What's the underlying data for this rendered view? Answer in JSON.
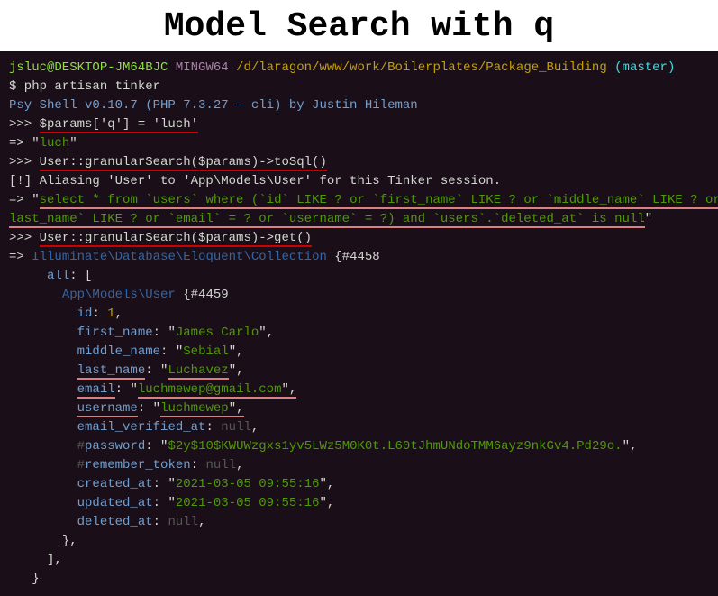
{
  "title": "Model Search with q",
  "prompt": {
    "user": "jsluc@DESKTOP-JM64BJC",
    "shell": " MINGW64 ",
    "path": "/d/laragon/www/work/Boilerplates/Package_Building",
    "branch": " (master)"
  },
  "cmd1": "$ php artisan tinker",
  "psy": "Psy Shell v0.10.7 (PHP 7.3.27 — cli) by Justin Hileman",
  "line1_prompt": ">>> ",
  "line1_code": "$params['q'] = 'luch'",
  "line2_arrow": "=> ",
  "line2_val": "luch",
  "line3_prompt": ">>> ",
  "line3_code": "User::granularSearch($params)->toSql()",
  "alias": "[!] Aliasing 'User' to 'App\\Models\\User' for this Tinker session.",
  "line4_arrow": "=> ",
  "line4_sql_a": "select * from `users` where (`id` LIKE ? or `first_name` LIKE ? or `middle_name` LIKE ? or `",
  "line4_sql_b": "last_name` LIKE ? or `email` = ? or `username` = ?) and `users`.`deleted_at` is null",
  "line5_prompt": ">>> ",
  "line5_code": "User::granularSearch($params)->get()",
  "line6_arrow": "=> ",
  "line6_cls": "Illuminate\\Database\\Eloquent\\Collection",
  "line6_obj": " {#4458",
  "line7_key": "all",
  "line7_rest": ": [",
  "line8_cls": "App\\Models\\User",
  "line8_obj": " {#4459",
  "fields": {
    "id": "id",
    "id_val": "1",
    "first_name": "first_name",
    "first_name_val": "James Carlo",
    "middle_name": "middle_name",
    "middle_name_val": "Sebial",
    "last_name": "last_name",
    "last_name_val": "Luchavez",
    "email": "email",
    "email_val": "luchmewep@gmail.com",
    "username": "username",
    "username_val": "luchmewep",
    "email_verified_at": "email_verified_at",
    "password": "password",
    "password_val": "$2y$10$KWUWzgxs1yv5LWz5M0K0t.L60tJhmUNdoTMM6ayz9nkGv4.Pd29o.",
    "remember_token": "remember_token",
    "created_at": "created_at",
    "created_at_val": "2021-03-05 09:55:16",
    "updated_at": "updated_at",
    "updated_at_val": "2021-03-05 09:55:16",
    "deleted_at": "deleted_at",
    "null": "null",
    "hash": "#"
  },
  "close1": "},",
  "close2": "],",
  "close3": "}"
}
